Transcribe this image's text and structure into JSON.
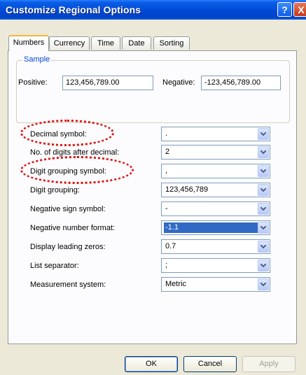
{
  "window": {
    "title": "Customize Regional Options",
    "help_label": "?",
    "close_label": "X"
  },
  "tabs": [
    {
      "label": "Numbers",
      "active": true
    },
    {
      "label": "Currency",
      "active": false
    },
    {
      "label": "Time",
      "active": false
    },
    {
      "label": "Date",
      "active": false
    },
    {
      "label": "Sorting",
      "active": false
    }
  ],
  "sample": {
    "group_title": "Sample",
    "positive_label": "Positive:",
    "positive_value": "123,456,789.00",
    "negative_label": "Negative:",
    "negative_value": "-123,456,789.00"
  },
  "settings": [
    {
      "label": "Decimal symbol:",
      "value": "."
    },
    {
      "label": "No. of digits after decimal:",
      "value": "2"
    },
    {
      "label": "Digit grouping symbol:",
      "value": ","
    },
    {
      "label": "Digit grouping:",
      "value": "123,456,789"
    },
    {
      "label": "Negative sign symbol:",
      "value": "-"
    },
    {
      "label": "Negative number format:",
      "value": "-1.1",
      "selected": true
    },
    {
      "label": "Display leading zeros:",
      "value": "0.7"
    },
    {
      "label": "List separator:",
      "value": ";"
    },
    {
      "label": "Measurement system:",
      "value": "Metric"
    }
  ],
  "buttons": {
    "ok": "OK",
    "cancel": "Cancel",
    "apply": "Apply"
  },
  "colors": {
    "annotation": "#e01010",
    "title_bar": "#0049d6",
    "selection": "#316ac5"
  },
  "icons": {
    "dropdown": "chevron-down-icon"
  }
}
